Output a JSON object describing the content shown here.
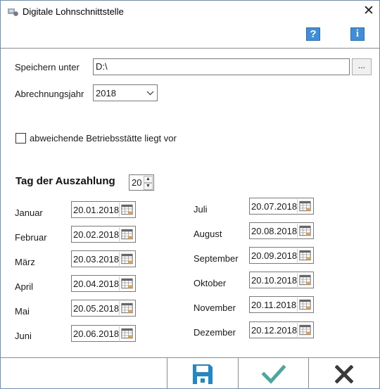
{
  "window": {
    "title": "Digitale Lohnschnittstelle",
    "close_glyph": "✕"
  },
  "toolbar": {
    "help_glyph": "?",
    "info_glyph": "i"
  },
  "form": {
    "speichern_label": "Speichern unter",
    "speichern_value": "D:\\",
    "browse_label": "...",
    "jahr_label": "Abrechnungsjahr",
    "jahr_value": "2018",
    "checkbox_label": "abweichende Betriebsstätte liegt vor",
    "tag_heading": "Tag der Auszahlung",
    "tag_value": "20"
  },
  "months_left": [
    {
      "label": "Januar",
      "date": "20.01.2018"
    },
    {
      "label": "Februar",
      "date": "20.02.2018"
    },
    {
      "label": "März",
      "date": "20.03.2018"
    },
    {
      "label": "April",
      "date": "20.04.2018"
    },
    {
      "label": "Mai",
      "date": "20.05.2018"
    },
    {
      "label": "Juni",
      "date": "20.06.2018"
    }
  ],
  "months_right": [
    {
      "label": "Juli",
      "date": "20.07.2018"
    },
    {
      "label": "August",
      "date": "20.08.2018"
    },
    {
      "label": "September",
      "date": "20.09.2018"
    },
    {
      "label": "Oktober",
      "date": "20.10.2018"
    },
    {
      "label": "November",
      "date": "20.11.2018"
    },
    {
      "label": "Dezember",
      "date": "20.12.2018"
    }
  ],
  "colors": {
    "save": "#1e88c9",
    "ok": "#4aa8a0",
    "cancel": "#3a3a3a",
    "help": "#3d8edb"
  }
}
